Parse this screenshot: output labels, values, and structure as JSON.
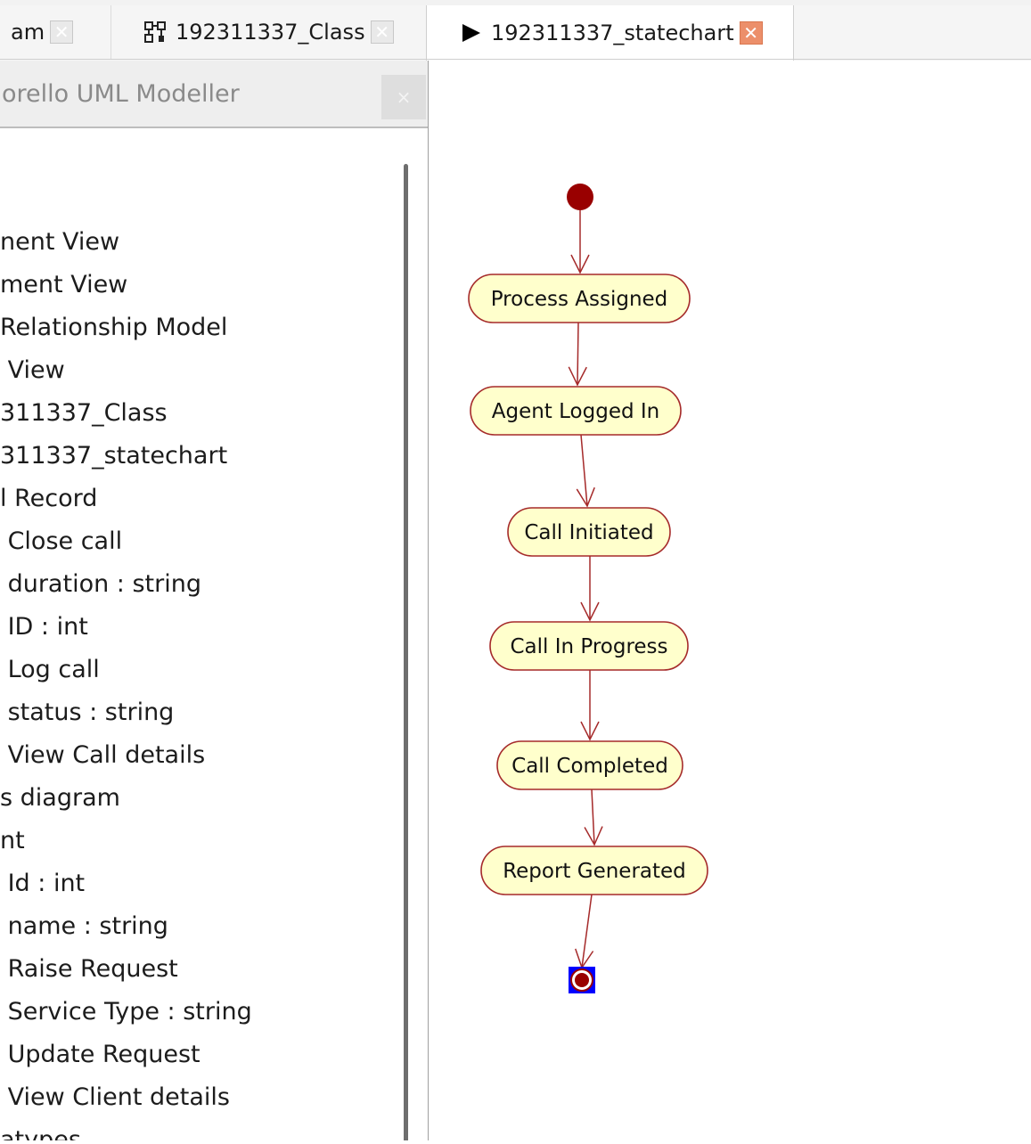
{
  "tabs": [
    {
      "label": "am",
      "active": false,
      "close": "✕"
    },
    {
      "label": "192311337_Class",
      "active": false,
      "close": "✕"
    },
    {
      "label": "192311337_statechart",
      "active": true,
      "close": "✕"
    }
  ],
  "panel": {
    "title": "orello UML Modeller",
    "close": "×",
    "tree_items": [
      "nent View",
      "ment View",
      "Relationship Model",
      " View",
      "311337_Class",
      "311337_statechart",
      "l Record",
      " Close call",
      " duration : string",
      " ID : int",
      " Log call",
      " status : string",
      " View Call details",
      "s diagram",
      "nt",
      " Id : int",
      " name : string",
      " Raise Request",
      " Service Type : string",
      " Update Request",
      " View Client details",
      "atypes"
    ]
  },
  "diagram": {
    "states": [
      "Process Assigned",
      "Agent Logged In",
      "Call Initiated",
      "Call In Progress",
      "Call Completed",
      "Report Generated"
    ],
    "colors": {
      "state_fill": "#ffffcc",
      "state_border": "#a52a2a",
      "initial_node": "#990000",
      "final_selection": "#0000ff"
    }
  }
}
